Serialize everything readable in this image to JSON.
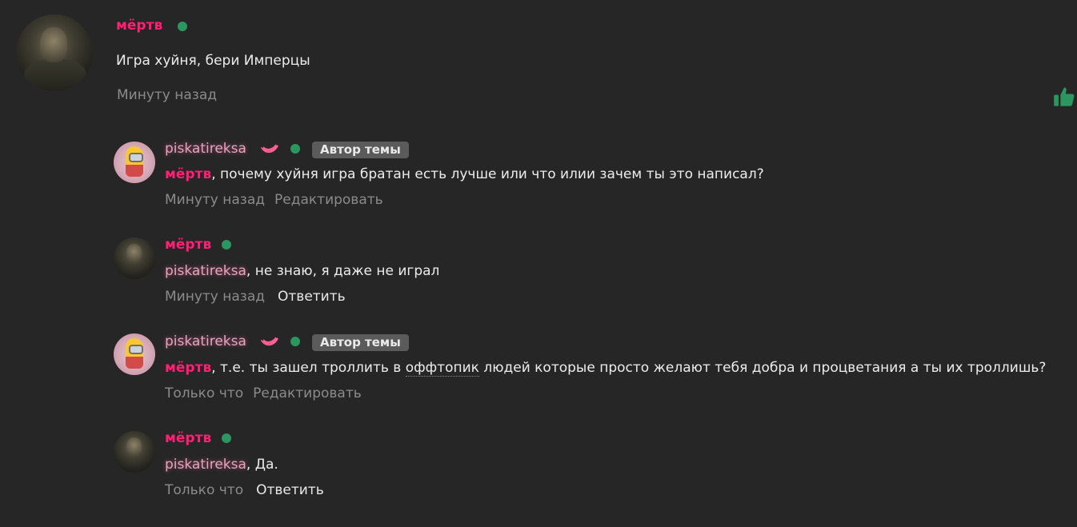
{
  "main_comment": {
    "author": "мёртв",
    "text": "Игра хуйня, бери Имперцы",
    "time": "Минуту назад"
  },
  "replies": [
    {
      "author": "piskatireksa",
      "badge": "Автор темы",
      "mention": "мёртв",
      "text": ", почему хуйня игра братан есть лучше или что илии зачем ты это написал?",
      "time": "Минуту назад",
      "action": "Редактировать"
    },
    {
      "author": "мёртв",
      "mention": "piskatireksa",
      "text": ", не знаю, я даже не играл",
      "time": "Минуту назад",
      "action": "Ответить"
    },
    {
      "author": "piskatireksa",
      "badge": "Автор темы",
      "mention": "мёртв",
      "text_before": ", т.е. ты зашел троллить в ",
      "text_link": "оффтопик",
      "text_after": " людей которые просто желают тебя добра и процветания а ты их троллишь?",
      "time": "Только что",
      "action": "Редактировать"
    },
    {
      "author": "мёртв",
      "mention": "piskatireksa",
      "text": ", Да.",
      "time": "Только что",
      "action": "Ответить"
    }
  ],
  "colors": {
    "background": "#262626",
    "username_red": "#ff1f74",
    "username_pink": "#e7a3bd",
    "online": "#2b9660",
    "like": "#2b9660"
  },
  "icons": {
    "like": "thumbs-up-icon",
    "banana": "banana-icon",
    "online": "online-status-dot"
  }
}
